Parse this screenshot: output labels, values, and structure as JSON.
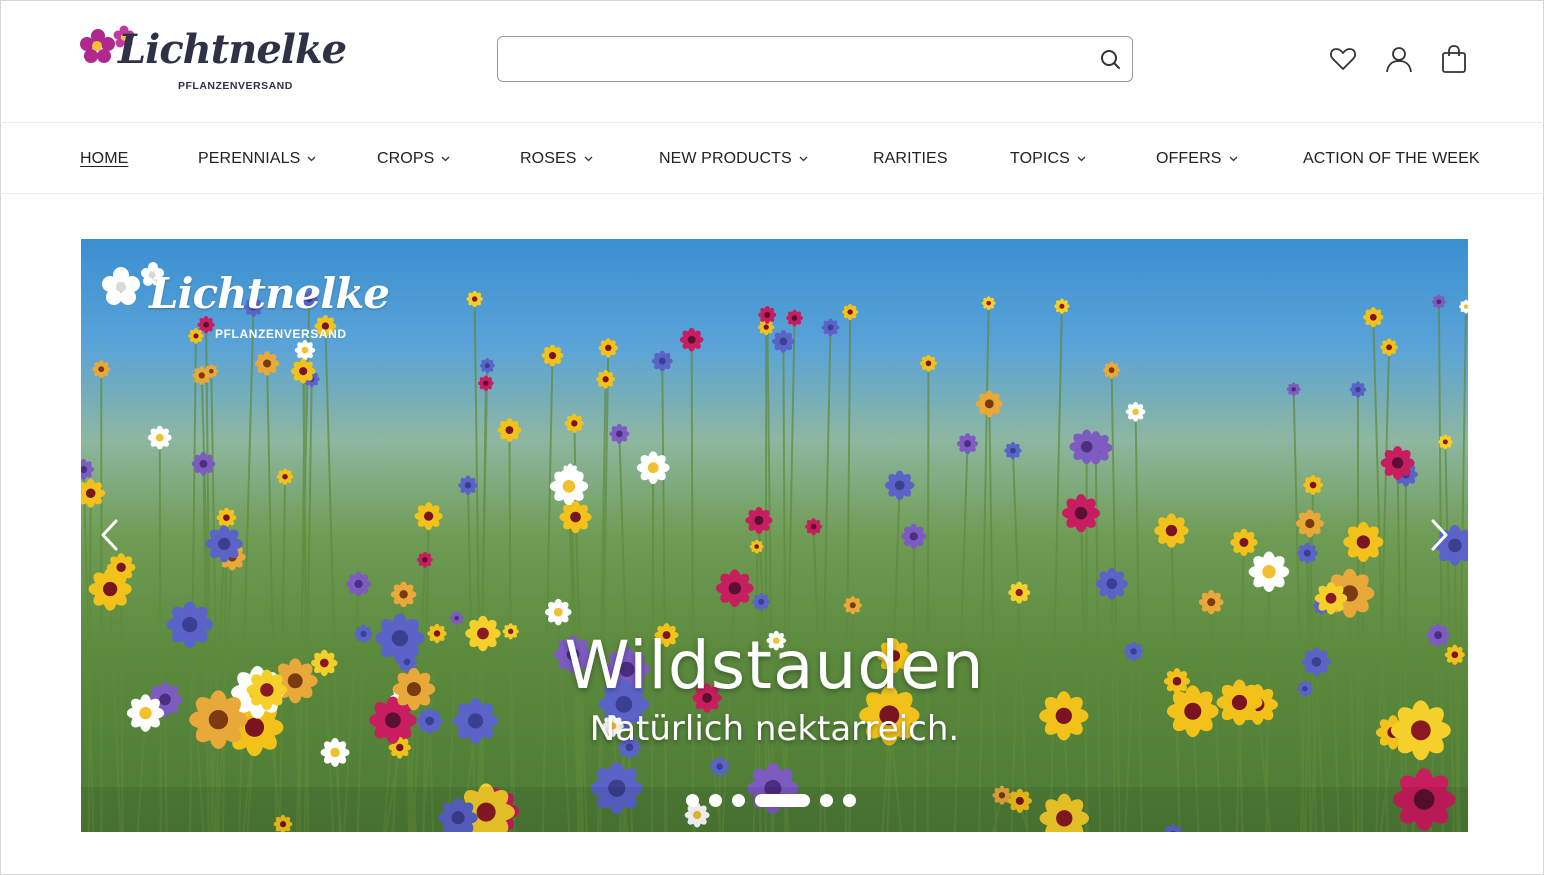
{
  "brand": {
    "name": "Lichtnelke",
    "tagline": "PFLANZENVERSAND",
    "color_primary": "#2f3147",
    "color_flower": "#b0288f"
  },
  "header": {
    "search": {
      "value": "",
      "placeholder": ""
    },
    "icons": [
      "search-icon",
      "heart-icon",
      "user-icon",
      "shopping-bag-icon"
    ]
  },
  "nav": {
    "items": [
      {
        "label": "HOME",
        "active": true,
        "dropdown": false
      },
      {
        "label": "PERENNIALS",
        "active": false,
        "dropdown": true
      },
      {
        "label": "CROPS",
        "active": false,
        "dropdown": true
      },
      {
        "label": "ROSES",
        "active": false,
        "dropdown": true
      },
      {
        "label": "NEW PRODUCTS",
        "active": false,
        "dropdown": true
      },
      {
        "label": "RARITIES",
        "active": false,
        "dropdown": false
      },
      {
        "label": "TOPICS",
        "active": false,
        "dropdown": true
      },
      {
        "label": "OFFERS",
        "active": false,
        "dropdown": true
      },
      {
        "label": "ACTION OF THE WEEK",
        "active": false,
        "dropdown": false
      }
    ]
  },
  "hero": {
    "logo_name": "Lichtnelke",
    "logo_tagline": "PFLANZENVERSAND",
    "title": "Wildstauden",
    "subtitle": "Natürlich nektarreich.",
    "slides_total": 6,
    "active_slide": 4,
    "icons": [
      "chevron-left-icon",
      "chevron-right-icon"
    ]
  }
}
